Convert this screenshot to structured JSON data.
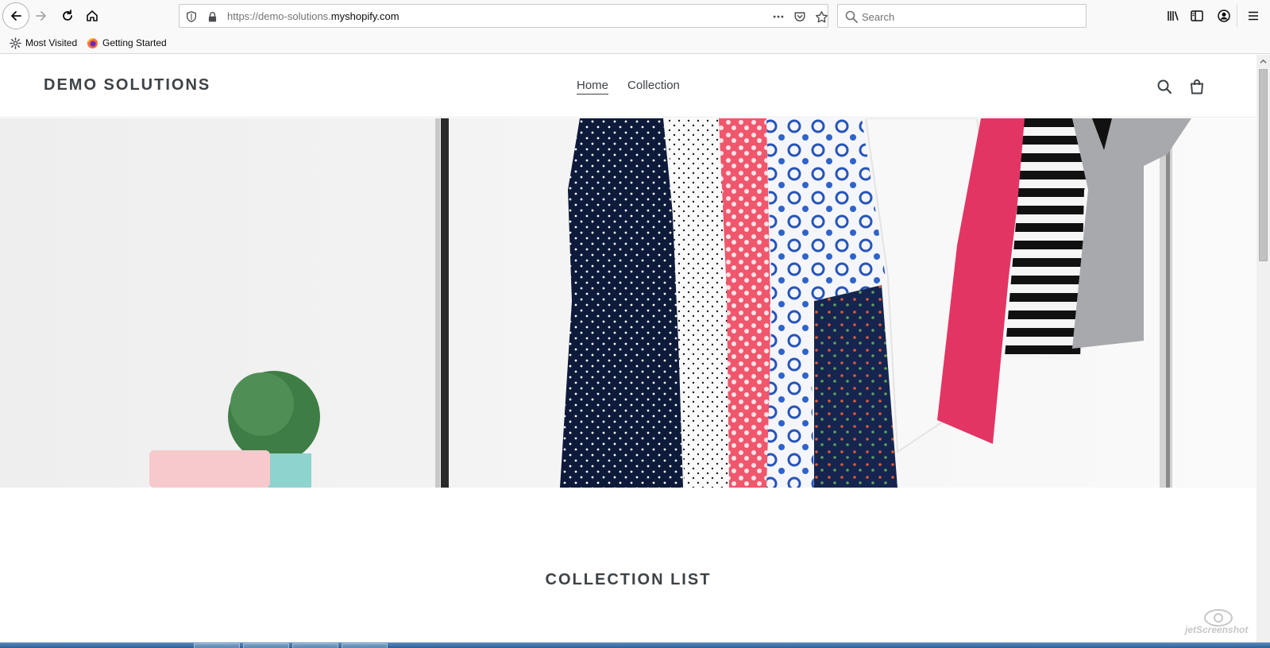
{
  "browser": {
    "url_prefix": "https://demo-solutions.",
    "url_domain": "myshopify.com",
    "search_placeholder": "Search",
    "bookmarks": [
      {
        "label": "Most Visited",
        "icon": "gear-icon"
      },
      {
        "label": "Getting Started",
        "icon": "firefox-icon"
      }
    ]
  },
  "site": {
    "logo": "DEMO SOLUTIONS",
    "nav": [
      {
        "label": "Home",
        "active": true
      },
      {
        "label": "Collection",
        "active": false
      }
    ],
    "section_title": "COLLECTION LIST"
  },
  "watermark": "jetScreenshot",
  "colors": {
    "text": "#3d4246",
    "browser_chrome": "#f9f9fa"
  }
}
